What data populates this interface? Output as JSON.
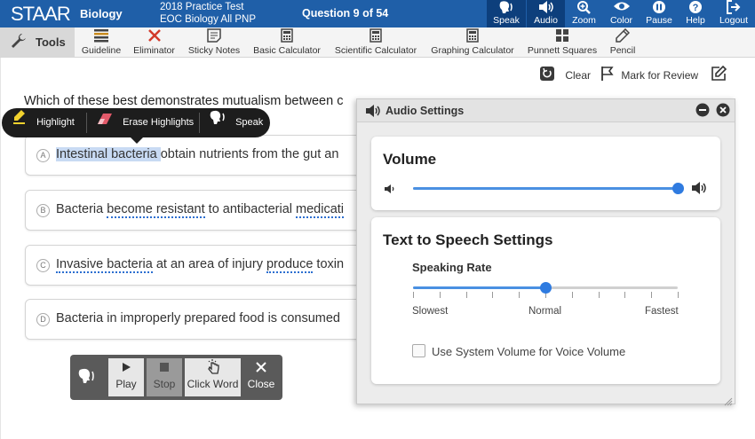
{
  "header": {
    "logo": "STAAR",
    "subject": "Biology",
    "test_title_line1": "2018 Practice Test",
    "test_title_line2": "EOC Biology All PNP",
    "question_counter": "Question 9 of 54",
    "buttons": [
      {
        "label": "Speak",
        "icon": "speak-icon"
      },
      {
        "label": "Audio",
        "icon": "audio-icon"
      },
      {
        "label": "Zoom",
        "icon": "zoom-icon"
      },
      {
        "label": "Color",
        "icon": "eye-icon"
      },
      {
        "label": "Pause",
        "icon": "pause-icon"
      },
      {
        "label": "Help",
        "icon": "help-icon"
      },
      {
        "label": "Logout",
        "icon": "logout-icon"
      }
    ]
  },
  "toolbar": {
    "tools_label": "Tools",
    "items": [
      {
        "label": "Guideline",
        "icon": "guideline-icon"
      },
      {
        "label": "Eliminator",
        "icon": "eliminator-icon"
      },
      {
        "label": "Sticky Notes",
        "icon": "sticky-notes-icon"
      },
      {
        "label": "Basic Calculator",
        "icon": "calculator-icon"
      },
      {
        "label": "Scientific Calculator",
        "icon": "calculator-icon"
      },
      {
        "label": "Graphing Calculator",
        "icon": "calculator-icon"
      },
      {
        "label": "Punnett Squares",
        "icon": "grid-icon"
      },
      {
        "label": "Pencil",
        "icon": "pencil-icon"
      }
    ]
  },
  "actions": {
    "clear_label": "Clear",
    "mark_review_label": "Mark for Review"
  },
  "question": {
    "text": "Which of these best demonstrates mutualism between c"
  },
  "highlight_popup": {
    "highlight_label": "Highlight",
    "erase_label": "Erase Highlights",
    "speak_label": "Speak"
  },
  "answers": [
    {
      "letter": "A",
      "text_highlight": "Intestinal bacteria ",
      "text_rest": "obtain nutrients from the gut an"
    },
    {
      "letter": "B",
      "text_a": "Bacteria ",
      "text_dot1": "become resistant",
      "text_b": " to antibacterial ",
      "text_dot2": "medicati"
    },
    {
      "letter": "C",
      "text_dot1": "Invasive bacteria",
      "text_a": " at an area of injury ",
      "text_dot2": "produce",
      "text_b": " toxin"
    },
    {
      "letter": "D",
      "text": "Bacteria in improperly prepared food is consumed"
    }
  ],
  "speech_bar": {
    "play_label": "Play",
    "stop_label": "Stop",
    "click_word_label": "Click Word",
    "close_label": "Close"
  },
  "audio_settings": {
    "title": "Audio Settings",
    "volume_title": "Volume",
    "volume_level": 1.0,
    "tts_title": "Text to Speech Settings",
    "speaking_rate_label": "Speaking Rate",
    "rate_labels": {
      "slowest": "Slowest",
      "normal": "Normal",
      "fastest": "Fastest"
    },
    "rate_level": 0.5,
    "system_volume_label": "Use System Volume for Voice Volume",
    "system_volume_checked": false
  },
  "colors": {
    "header_bg": "#1f5fa8",
    "accent": "#2f7be0"
  }
}
